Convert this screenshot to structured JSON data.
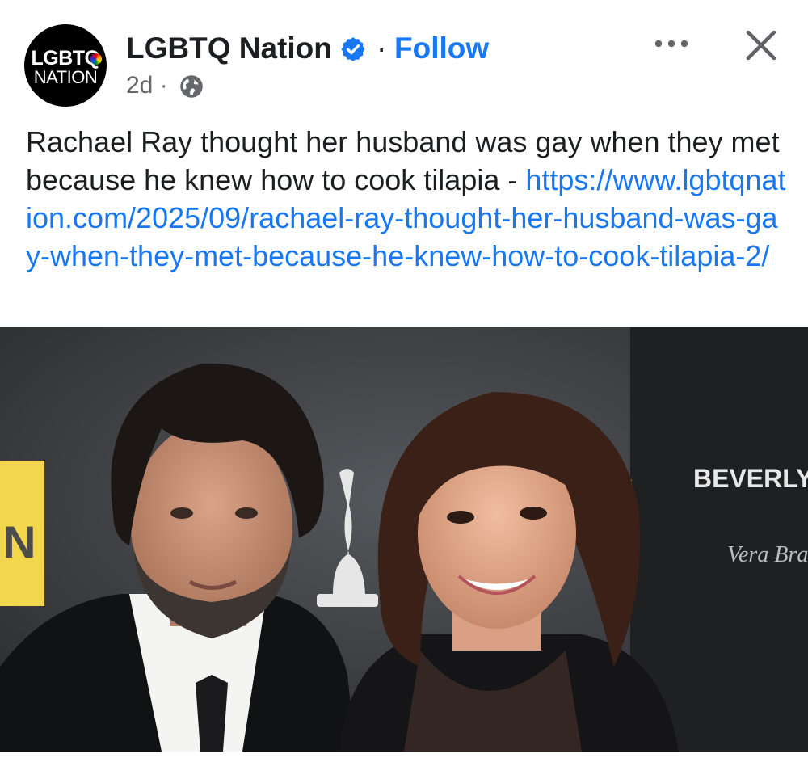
{
  "page": {
    "avatar_line1": "LGBTQ",
    "avatar_line2": "NATION",
    "name": "LGBTQ Nation",
    "separator": "·",
    "follow_label": "Follow",
    "timestamp": "2d ·"
  },
  "post": {
    "text": "Rachael Ray thought her husband was gay when they met because he knew how to cook tilapia - ",
    "link": "https://www.lgbtqnation.com/2025/09/rachael-ray-thought-her-husband-was-gay-when-they-met-because-he-knew-how-to-cook-tilapia-2/"
  },
  "photo": {
    "backdrop_text": "BEVERLY H",
    "signature_text": "Vera Bra",
    "left_panel_text": "N"
  },
  "icons": {
    "verified": "verified-badge-icon",
    "audience": "globe-icon",
    "more": "more-options-icon",
    "close": "close-icon"
  },
  "colors": {
    "accent": "#1877f2",
    "text": "#1c1e21",
    "muted": "#65676b"
  }
}
